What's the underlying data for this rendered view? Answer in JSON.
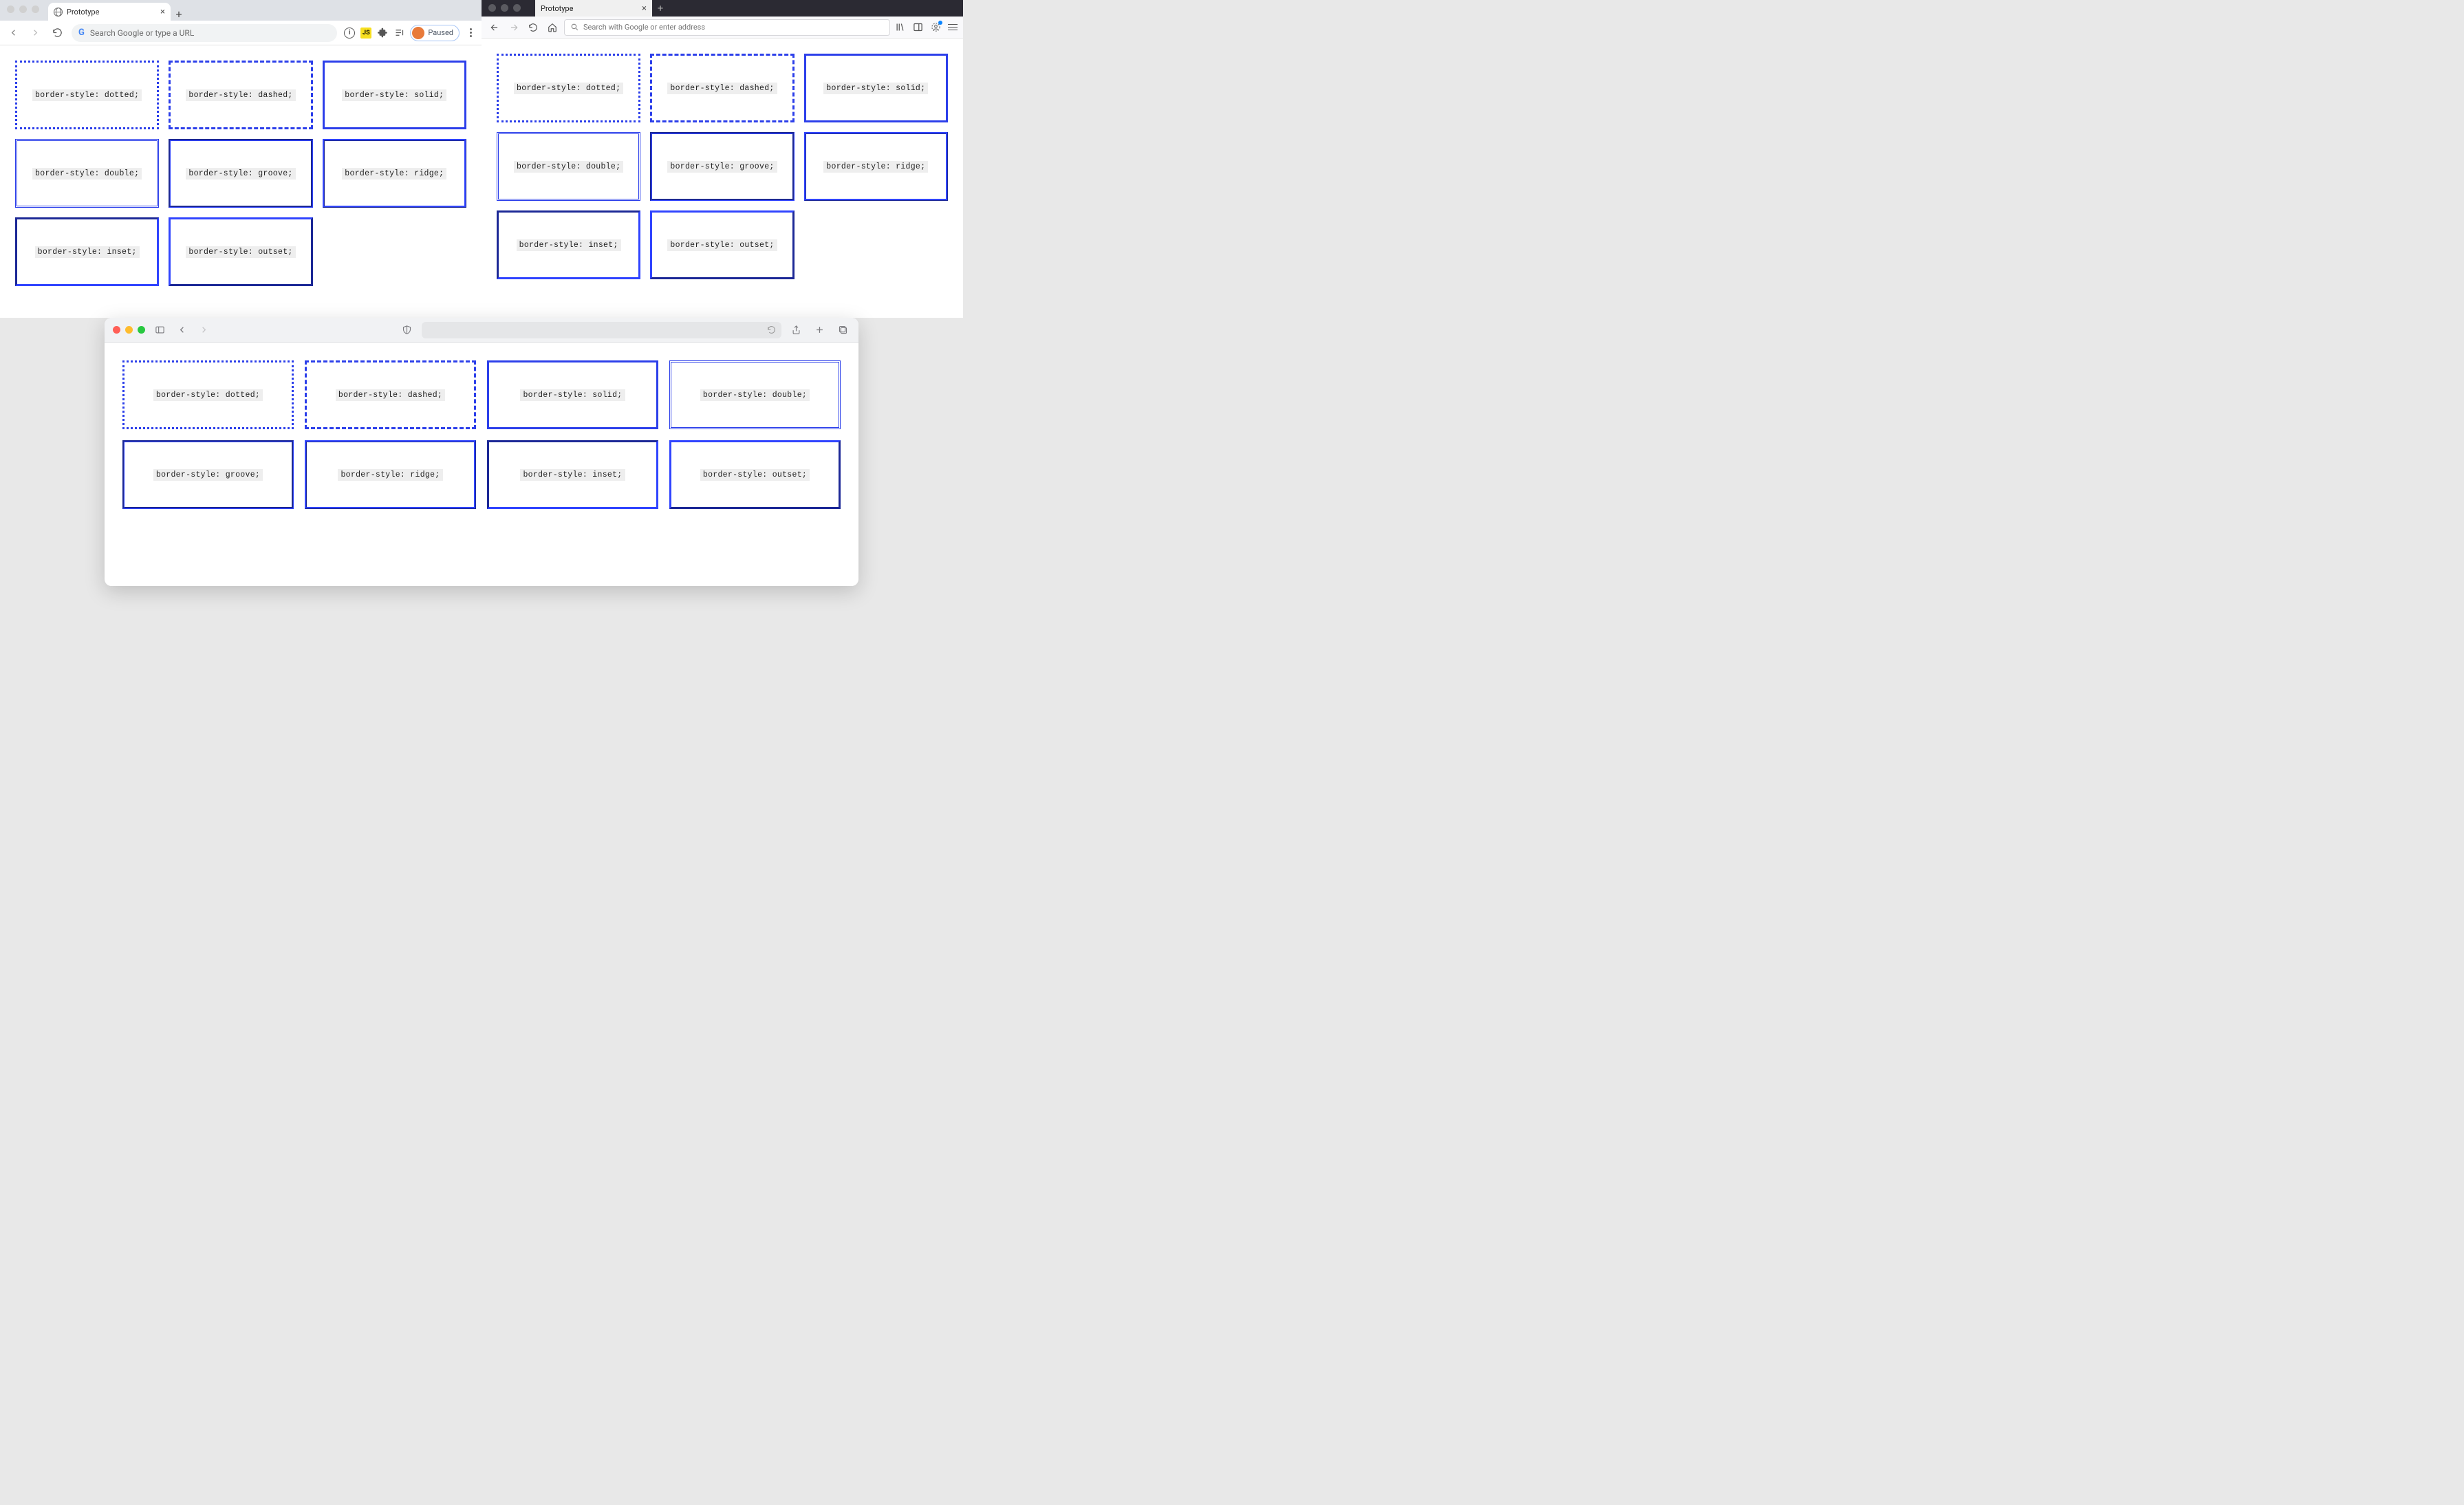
{
  "chrome": {
    "tab_title": "Prototype",
    "address_placeholder": "Search Google or type a URL",
    "paused_label": "Paused"
  },
  "firefox": {
    "tab_title": "Prototype",
    "address_placeholder": "Search with Google or enter address"
  },
  "border_color": "#2c3fea",
  "boxes": [
    {
      "label": "border-style: dotted;",
      "style": "dotted"
    },
    {
      "label": "border-style: dashed;",
      "style": "dashed"
    },
    {
      "label": "border-style: solid;",
      "style": "solid"
    },
    {
      "label": "border-style: double;",
      "style": "double"
    },
    {
      "label": "border-style: groove;",
      "style": "groove"
    },
    {
      "label": "border-style: ridge;",
      "style": "ridge"
    },
    {
      "label": "border-style: inset;",
      "style": "inset"
    },
    {
      "label": "border-style: outset;",
      "style": "outset"
    }
  ]
}
